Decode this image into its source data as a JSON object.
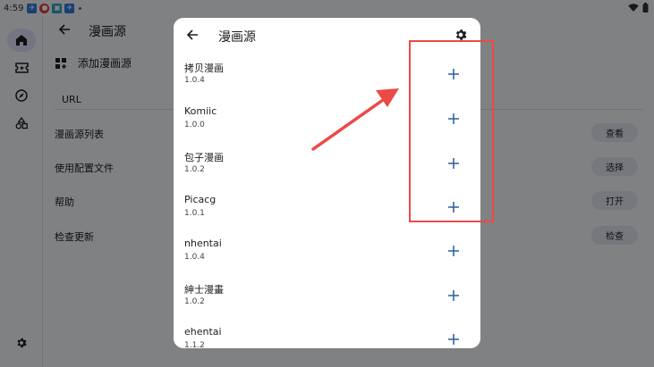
{
  "status_bar": {
    "time": "4:59"
  },
  "rail": {
    "items": [
      {
        "name": "home-icon",
        "active": true
      },
      {
        "name": "ticket-icon",
        "active": false
      },
      {
        "name": "compass-icon",
        "active": false
      },
      {
        "name": "shapes-icon",
        "active": false
      }
    ],
    "settings_icon": "gear-icon"
  },
  "page": {
    "title": "漫画源",
    "add_source_label": "添加漫画源",
    "url_label": "URL",
    "rows": [
      {
        "label": "漫画源列表",
        "button": "查看"
      },
      {
        "label": "使用配置文件",
        "button": "选择"
      },
      {
        "label": "帮助",
        "button": "打开"
      },
      {
        "label": "检查更新",
        "button": "检查"
      }
    ]
  },
  "dialog": {
    "title": "漫画源",
    "sources": [
      {
        "name": "拷贝漫画",
        "version": "1.0.4"
      },
      {
        "name": "Komiic",
        "version": "1.0.0"
      },
      {
        "name": "包子漫画",
        "version": "1.0.2"
      },
      {
        "name": "Picacg",
        "version": "1.0.1"
      },
      {
        "name": "nhentai",
        "version": "1.0.4"
      },
      {
        "name": "紳士漫畫",
        "version": "1.0.2"
      },
      {
        "name": "ehentai",
        "version": "1.1.2"
      }
    ],
    "add_icon": "plus-icon"
  },
  "colors": {
    "annotation": "#ec4a46",
    "accent": "#2b5d9e",
    "background": "#f5f7fc"
  }
}
